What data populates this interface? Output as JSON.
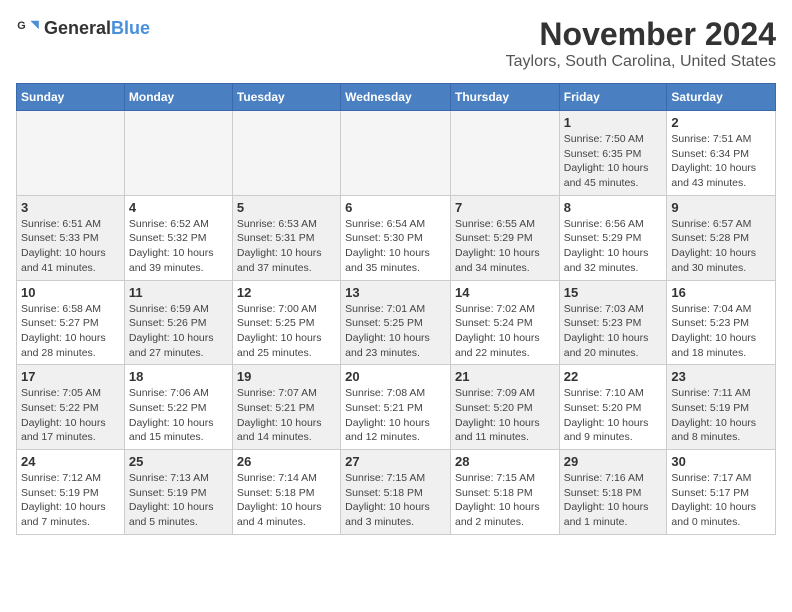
{
  "header": {
    "logo_general": "General",
    "logo_blue": "Blue",
    "title": "November 2024",
    "subtitle": "Taylors, South Carolina, United States"
  },
  "calendar": {
    "days_of_week": [
      "Sunday",
      "Monday",
      "Tuesday",
      "Wednesday",
      "Thursday",
      "Friday",
      "Saturday"
    ],
    "weeks": [
      [
        {
          "day": "",
          "info": "",
          "empty": true
        },
        {
          "day": "",
          "info": "",
          "empty": true
        },
        {
          "day": "",
          "info": "",
          "empty": true
        },
        {
          "day": "",
          "info": "",
          "empty": true
        },
        {
          "day": "",
          "info": "",
          "empty": true
        },
        {
          "day": "1",
          "info": "Sunrise: 7:50 AM\nSunset: 6:35 PM\nDaylight: 10 hours and 45 minutes.",
          "shaded": true
        },
        {
          "day": "2",
          "info": "Sunrise: 7:51 AM\nSunset: 6:34 PM\nDaylight: 10 hours and 43 minutes.",
          "shaded": false
        }
      ],
      [
        {
          "day": "3",
          "info": "Sunrise: 6:51 AM\nSunset: 5:33 PM\nDaylight: 10 hours and 41 minutes.",
          "shaded": true
        },
        {
          "day": "4",
          "info": "Sunrise: 6:52 AM\nSunset: 5:32 PM\nDaylight: 10 hours and 39 minutes.",
          "shaded": false
        },
        {
          "day": "5",
          "info": "Sunrise: 6:53 AM\nSunset: 5:31 PM\nDaylight: 10 hours and 37 minutes.",
          "shaded": true
        },
        {
          "day": "6",
          "info": "Sunrise: 6:54 AM\nSunset: 5:30 PM\nDaylight: 10 hours and 35 minutes.",
          "shaded": false
        },
        {
          "day": "7",
          "info": "Sunrise: 6:55 AM\nSunset: 5:29 PM\nDaylight: 10 hours and 34 minutes.",
          "shaded": true
        },
        {
          "day": "8",
          "info": "Sunrise: 6:56 AM\nSunset: 5:29 PM\nDaylight: 10 hours and 32 minutes.",
          "shaded": false
        },
        {
          "day": "9",
          "info": "Sunrise: 6:57 AM\nSunset: 5:28 PM\nDaylight: 10 hours and 30 minutes.",
          "shaded": true
        }
      ],
      [
        {
          "day": "10",
          "info": "Sunrise: 6:58 AM\nSunset: 5:27 PM\nDaylight: 10 hours and 28 minutes.",
          "shaded": false
        },
        {
          "day": "11",
          "info": "Sunrise: 6:59 AM\nSunset: 5:26 PM\nDaylight: 10 hours and 27 minutes.",
          "shaded": true
        },
        {
          "day": "12",
          "info": "Sunrise: 7:00 AM\nSunset: 5:25 PM\nDaylight: 10 hours and 25 minutes.",
          "shaded": false
        },
        {
          "day": "13",
          "info": "Sunrise: 7:01 AM\nSunset: 5:25 PM\nDaylight: 10 hours and 23 minutes.",
          "shaded": true
        },
        {
          "day": "14",
          "info": "Sunrise: 7:02 AM\nSunset: 5:24 PM\nDaylight: 10 hours and 22 minutes.",
          "shaded": false
        },
        {
          "day": "15",
          "info": "Sunrise: 7:03 AM\nSunset: 5:23 PM\nDaylight: 10 hours and 20 minutes.",
          "shaded": true
        },
        {
          "day": "16",
          "info": "Sunrise: 7:04 AM\nSunset: 5:23 PM\nDaylight: 10 hours and 18 minutes.",
          "shaded": false
        }
      ],
      [
        {
          "day": "17",
          "info": "Sunrise: 7:05 AM\nSunset: 5:22 PM\nDaylight: 10 hours and 17 minutes.",
          "shaded": true
        },
        {
          "day": "18",
          "info": "Sunrise: 7:06 AM\nSunset: 5:22 PM\nDaylight: 10 hours and 15 minutes.",
          "shaded": false
        },
        {
          "day": "19",
          "info": "Sunrise: 7:07 AM\nSunset: 5:21 PM\nDaylight: 10 hours and 14 minutes.",
          "shaded": true
        },
        {
          "day": "20",
          "info": "Sunrise: 7:08 AM\nSunset: 5:21 PM\nDaylight: 10 hours and 12 minutes.",
          "shaded": false
        },
        {
          "day": "21",
          "info": "Sunrise: 7:09 AM\nSunset: 5:20 PM\nDaylight: 10 hours and 11 minutes.",
          "shaded": true
        },
        {
          "day": "22",
          "info": "Sunrise: 7:10 AM\nSunset: 5:20 PM\nDaylight: 10 hours and 9 minutes.",
          "shaded": false
        },
        {
          "day": "23",
          "info": "Sunrise: 7:11 AM\nSunset: 5:19 PM\nDaylight: 10 hours and 8 minutes.",
          "shaded": true
        }
      ],
      [
        {
          "day": "24",
          "info": "Sunrise: 7:12 AM\nSunset: 5:19 PM\nDaylight: 10 hours and 7 minutes.",
          "shaded": false
        },
        {
          "day": "25",
          "info": "Sunrise: 7:13 AM\nSunset: 5:19 PM\nDaylight: 10 hours and 5 minutes.",
          "shaded": true
        },
        {
          "day": "26",
          "info": "Sunrise: 7:14 AM\nSunset: 5:18 PM\nDaylight: 10 hours and 4 minutes.",
          "shaded": false
        },
        {
          "day": "27",
          "info": "Sunrise: 7:15 AM\nSunset: 5:18 PM\nDaylight: 10 hours and 3 minutes.",
          "shaded": true
        },
        {
          "day": "28",
          "info": "Sunrise: 7:15 AM\nSunset: 5:18 PM\nDaylight: 10 hours and 2 minutes.",
          "shaded": false
        },
        {
          "day": "29",
          "info": "Sunrise: 7:16 AM\nSunset: 5:18 PM\nDaylight: 10 hours and 1 minute.",
          "shaded": true
        },
        {
          "day": "30",
          "info": "Sunrise: 7:17 AM\nSunset: 5:17 PM\nDaylight: 10 hours and 0 minutes.",
          "shaded": false
        }
      ]
    ]
  }
}
